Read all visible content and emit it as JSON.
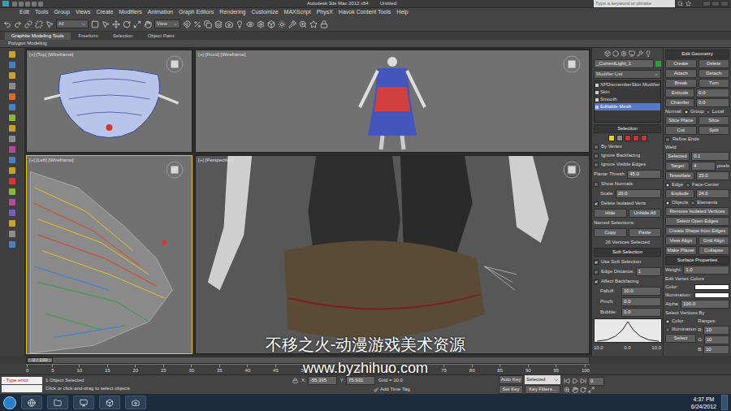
{
  "window": {
    "app": "Autodesk 3ds Max 2012 x64",
    "document": "Untitled"
  },
  "search": {
    "placeholder": "Type a keyword or phrase"
  },
  "menu": [
    "Edit",
    "Tools",
    "Group",
    "Views",
    "Create",
    "Modifiers",
    "Animation",
    "Graph Editors",
    "Rendering",
    "Customize",
    "MAXScript",
    "PhysX",
    "Havok Content Tools",
    "Help"
  ],
  "toolbar": {
    "selection_filter": "All",
    "reference_coord": "View"
  },
  "ribbon": {
    "tabs": [
      {
        "label": "Graphite Modeling Tools",
        "selected": true
      },
      {
        "label": "Freeform",
        "selected": false
      },
      {
        "label": "Selection",
        "selected": false
      },
      {
        "label": "Object Paint",
        "selected": false
      }
    ],
    "panel": "Polygon Modeling"
  },
  "viewports": [
    {
      "label": "[+] [Top] [Wireframe]",
      "active": false
    },
    {
      "label": "[+] [Front] [Wireframe]",
      "active": false
    },
    {
      "label": "[+] [Left] [Wireframe]",
      "active": true
    },
    {
      "label": "[+] [Perspective]",
      "active": false
    }
  ],
  "command_panel": {
    "object_name": "_CurrentLight_1",
    "modifier_list": "Modifier List",
    "stack": [
      {
        "label": "XPDismemberSkin Modifier",
        "selected": false
      },
      {
        "label": "Skin",
        "selected": false
      },
      {
        "label": "Smooth",
        "selected": false
      },
      {
        "label": "Editable Mesh",
        "selected": true
      }
    ],
    "selection": {
      "title": "Selection",
      "options": [
        {
          "label": "By Vertex",
          "checked": false
        },
        {
          "label": "Ignore Backfacing",
          "checked": false
        },
        {
          "label": "Ignore Visible Edges",
          "checked": false
        }
      ],
      "planar_label": "Planar Thresh:",
      "planar_value": "45.0",
      "show_normals": {
        "label": "Show Normals",
        "checked": false
      },
      "scale_label": "Scale:",
      "scale": "20.0",
      "delete_isolated": {
        "label": "Delete Isolated Verts",
        "checked": true
      },
      "hide": "Hide",
      "unhide": "Unhide All",
      "named": "Named Selections:",
      "copy": "Copy",
      "paste": "Paste",
      "status": "26 Vertices Selected"
    },
    "soft_selection": {
      "title": "Soft Selection",
      "use": {
        "label": "Use Soft Selection",
        "checked": true
      },
      "edge": {
        "label": "Edge Distance:",
        "checked": false,
        "value": "1"
      },
      "affect": {
        "label": "Affect Backfacing",
        "checked": true
      },
      "params": [
        {
          "label": "Falloff:",
          "value": "10.0"
        },
        {
          "label": "Pinch:",
          "value": "0.0"
        },
        {
          "label": "Bubble:",
          "value": "0.0"
        }
      ],
      "graph_ticks": [
        "10.0",
        "0.0",
        "10.0"
      ]
    }
  },
  "edit_geometry": {
    "title": "Edit Geometry",
    "button_rows": [
      [
        "Create",
        "Delete"
      ],
      [
        "Attach",
        "Detach"
      ],
      [
        "Break",
        "Turn"
      ]
    ],
    "spinners": [
      {
        "label": "Extrude",
        "value": "0.0"
      },
      {
        "label": "Chamfer",
        "value": "0.0"
      }
    ],
    "normal": {
      "label": "Normal:",
      "options": [
        {
          "label": "Group",
          "selected": true
        },
        {
          "label": "Local",
          "selected": false
        }
      ]
    },
    "rows2": [
      [
        "Slice Plane",
        "Slice"
      ],
      [
        "Cut",
        "Split"
      ]
    ],
    "refine": {
      "label": "Refine Ends",
      "checked": false
    },
    "weld_title": "Weld",
    "weld": [
      {
        "button": "Selected",
        "value": "0.1",
        "unit": ""
      },
      {
        "button": "Target",
        "value": "4",
        "unit": "pixels"
      }
    ],
    "tessellate": {
      "button": "Tessellate",
      "value": "25.0"
    },
    "tess_options": [
      {
        "label": "Edge",
        "selected": true
      },
      {
        "label": "Face-Center",
        "selected": false
      }
    ],
    "explode": {
      "button": "Explode",
      "value": "24.0"
    },
    "explode_options": [
      {
        "label": "Objects",
        "selected": true
      },
      {
        "label": "Elements",
        "selected": false
      }
    ],
    "full_buttons": [
      "Remove Isolated Vertices",
      "Select Open Edges",
      "Create Shape from Edges"
    ],
    "rows3": [
      [
        "View Align",
        "Grid Align"
      ],
      [
        "Make Planar",
        "Collapse"
      ]
    ]
  },
  "surface_properties": {
    "title": "Surface Properties",
    "weight_label": "Weight:",
    "weight": "1.0",
    "vertex_colors": "Edit Vertex Colors",
    "color_fields": [
      {
        "label": "Color:",
        "color": "#ffffff"
      },
      {
        "label": "Illumination:",
        "color": "#ffffff"
      }
    ],
    "alpha_label": "Alpha:",
    "alpha": "100.0",
    "select_by": "Select Vertices By",
    "select_options": [
      {
        "label": "Color",
        "selected": true
      },
      {
        "label": "Illumination",
        "selected": false
      }
    ],
    "range_label": "Ranges:",
    "ranges": [
      {
        "label": "R:",
        "value": "10"
      },
      {
        "label": "G:",
        "value": "10"
      },
      {
        "label": "B:",
        "value": "10"
      }
    ],
    "select_button": "Select"
  },
  "time_slider": {
    "label": "0 / 100",
    "level": 0
  },
  "ruler": [
    "0",
    "5",
    "10",
    "15",
    "20",
    "25",
    "30",
    "35",
    "40",
    "45",
    "50",
    "55",
    "60",
    "65",
    "70",
    "75",
    "80",
    "85",
    "90",
    "95",
    "100"
  ],
  "status_bar": {
    "script_error": "- Type error",
    "selection": "1 Object Selected",
    "prompt": "Click or click-and-drag to select objects",
    "coords": [
      {
        "label": "X:",
        "value": "-55.335"
      },
      {
        "label": "Y:",
        "value": "75.931"
      }
    ],
    "grid": "Grid = 10.0",
    "time_tag": "Add Time Tag",
    "auto_key": "Auto Key",
    "key_mode": "Selected",
    "set_key": "Set Key",
    "key_filters": "Key Filters...",
    "frame": "0"
  },
  "taskbar": {
    "time": "4:37 PM",
    "date": "6/24/2012"
  },
  "watermark": {
    "line1": "不移之火-动漫游戏美术资源",
    "line2": "www.byzhihuo.com"
  }
}
